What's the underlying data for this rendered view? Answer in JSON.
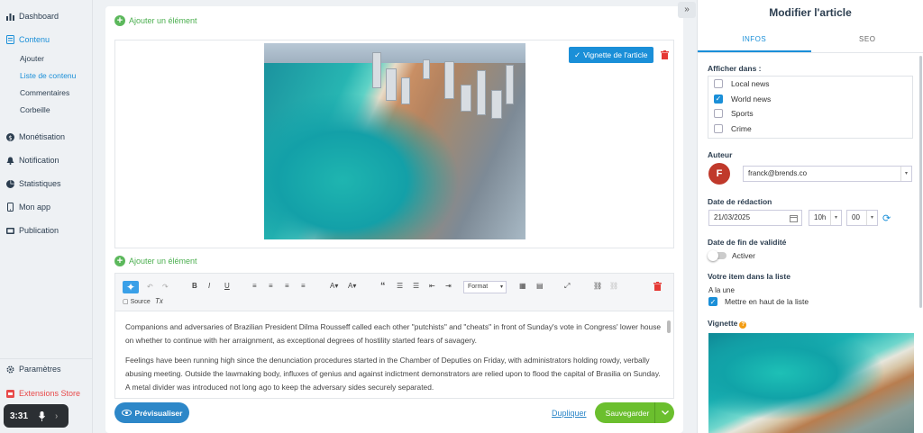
{
  "sidebar": {
    "items": [
      {
        "label": "Dashboard",
        "icon": "bar-chart-icon"
      },
      {
        "label": "Contenu",
        "icon": "document-icon"
      },
      {
        "label": "Monétisation",
        "icon": "dollar-icon"
      },
      {
        "label": "Notification",
        "icon": "bell-icon"
      },
      {
        "label": "Statistiques",
        "icon": "pie-chart-icon"
      },
      {
        "label": "Mon app",
        "icon": "phone-icon"
      },
      {
        "label": "Publication",
        "icon": "publish-icon"
      }
    ],
    "sub_items": [
      "Ajouter",
      "Liste de contenu",
      "Commentaires",
      "Corbeille"
    ],
    "bottom": [
      {
        "label": "Paramètres",
        "icon": "gear-icon"
      },
      {
        "label": "Extensions Store",
        "icon": "store-icon"
      }
    ]
  },
  "recorder": {
    "time": "3:31"
  },
  "editor": {
    "add_element": "Ajouter un élément",
    "vignette_button": "Vignette de l'article",
    "toolbar": {
      "format": "Format",
      "source": "Source"
    },
    "paragraphs": [
      "Companions and adversaries of Brazilian President Dilma Rousseff called each other \"putchists\" and \"cheats\" in front of Sunday's vote in Congress' lower house on whether to continue with her arraignment, as exceptional degrees of hostility started fears of savagery.",
      "Feelings have been running high since the denunciation procedures started in the Chamber of Deputies on Friday, with administrators holding rowdy, verbally abusing meeting. Outside the lawmaking body, influxes of genius and against indictment demonstrators are relied upon to flood the capital of Brasilia on Sunday. A metal divider was introduced not long ago to keep the adversary sides securely separated."
    ],
    "footer": {
      "preview": "Prévisualiser",
      "duplicate": "Dupliquer",
      "save": "Sauvegarder"
    }
  },
  "panel": {
    "title": "Modifier l'article",
    "tabs": [
      "INFOS",
      "SEO"
    ],
    "show_in_label": "Afficher dans :",
    "categories": [
      {
        "label": "Local news",
        "checked": false
      },
      {
        "label": "World news",
        "checked": true
      },
      {
        "label": "Sports",
        "checked": false
      },
      {
        "label": "Crime",
        "checked": false
      }
    ],
    "author_label": "Auteur",
    "author_initial": "F",
    "author_email": "franck@brends.co",
    "date_label": "Date de rédaction",
    "date_value": "21/03/2025",
    "hour_value": "10h",
    "minute_value": "00",
    "expiry_label": "Date de fin de validité",
    "expiry_toggle": "Activer",
    "list_label": "Votre item dans la liste",
    "headline_label": "A la une",
    "pin_top_label": "Mettre en haut de la liste",
    "vignette_label": "Vignette",
    "colors": {
      "accent": "#1a8fd8",
      "save": "#6bbf2e",
      "danger": "#e53935"
    }
  }
}
